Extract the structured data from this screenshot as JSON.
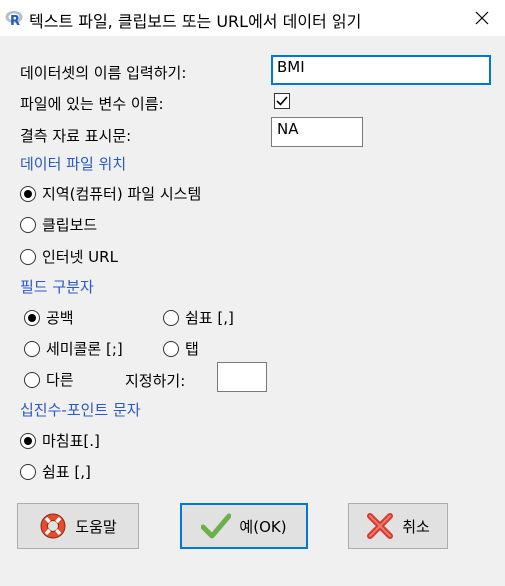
{
  "window": {
    "title": "텍스트 파일, 클립보드 또는 URL에서 데이터 읽기",
    "app_icon": "r-logo-icon",
    "close_icon": "close-icon"
  },
  "form": {
    "dataset_name_label": "데이터셋의 이름 입력하기:",
    "dataset_name_value": "BMI",
    "var_names_label": "파일에 있는 변수 이름:",
    "var_names_checked": true,
    "missing_label": "결측 자료 표시문:",
    "missing_value": "NA"
  },
  "location": {
    "header": "데이터 파일 위치",
    "options": [
      {
        "label": "지역(컴퓨터) 파일 시스템",
        "selected": true
      },
      {
        "label": "클립보드",
        "selected": false
      },
      {
        "label": "인터넷 URL",
        "selected": false
      }
    ]
  },
  "field_sep": {
    "header": "필드 구분자",
    "options": [
      {
        "label": "공백",
        "selected": true
      },
      {
        "label": "쉼표 [,]",
        "selected": false
      },
      {
        "label": "세미콜론 [;]",
        "selected": false
      },
      {
        "label": "탭",
        "selected": false
      },
      {
        "label": "다른",
        "selected": false
      }
    ],
    "specify_label": "지정하기:",
    "specify_value": ""
  },
  "decimal": {
    "header": "십진수-포인트 문자",
    "options": [
      {
        "label": "마침표[.]",
        "selected": true
      },
      {
        "label": "쉼표 [,]",
        "selected": false
      }
    ]
  },
  "buttons": {
    "help": "도움말",
    "ok": "예(OK)",
    "cancel": "취소",
    "help_icon": "lifebuoy-icon",
    "ok_icon": "checkmark-icon",
    "cancel_icon": "red-x-icon"
  },
  "colors": {
    "section_header": "#2a58c8",
    "focus_border": "#0078d7"
  }
}
